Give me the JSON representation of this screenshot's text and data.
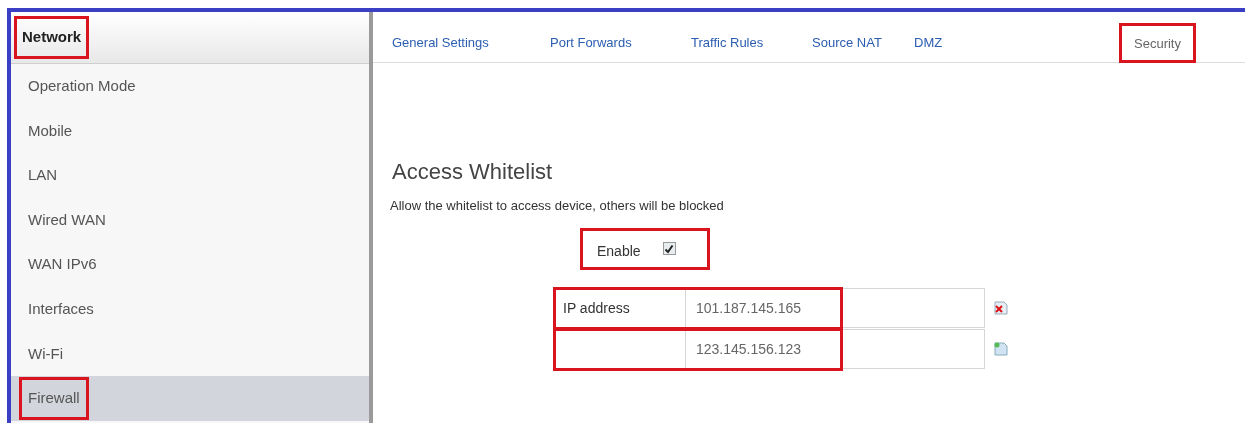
{
  "sidebar": {
    "header": {
      "label": "Network",
      "highlighted": true
    },
    "items": [
      {
        "label": "Operation Mode",
        "selected": false,
        "highlighted": false
      },
      {
        "label": "Mobile",
        "selected": false,
        "highlighted": false
      },
      {
        "label": "LAN",
        "selected": false,
        "highlighted": false
      },
      {
        "label": "Wired WAN",
        "selected": false,
        "highlighted": false
      },
      {
        "label": "WAN IPv6",
        "selected": false,
        "highlighted": false
      },
      {
        "label": "Interfaces",
        "selected": false,
        "highlighted": false
      },
      {
        "label": "Wi-Fi",
        "selected": false,
        "highlighted": false
      },
      {
        "label": "Firewall",
        "selected": true,
        "highlighted": true
      }
    ]
  },
  "tabs": [
    {
      "label": "General Settings",
      "selected": false,
      "highlighted": false
    },
    {
      "label": "Port Forwards",
      "selected": false,
      "highlighted": false
    },
    {
      "label": "Traffic Rules",
      "selected": false,
      "highlighted": false
    },
    {
      "label": "Source NAT",
      "selected": false,
      "highlighted": false
    },
    {
      "label": "DMZ",
      "selected": false,
      "highlighted": false
    },
    {
      "label": "Security",
      "selected": true,
      "highlighted": true
    }
  ],
  "section": {
    "title": "Access Whitelist",
    "description": "Allow the whitelist to access device, others will be blocked",
    "enable": {
      "label": "Enable",
      "checked": true,
      "highlighted": true
    },
    "rows": [
      {
        "label": "IP address",
        "value": "101.187.145.165",
        "kind": "remove",
        "highlighted": true
      },
      {
        "value": "123.145.156.123",
        "kind": "add",
        "highlighted": true
      }
    ]
  }
}
